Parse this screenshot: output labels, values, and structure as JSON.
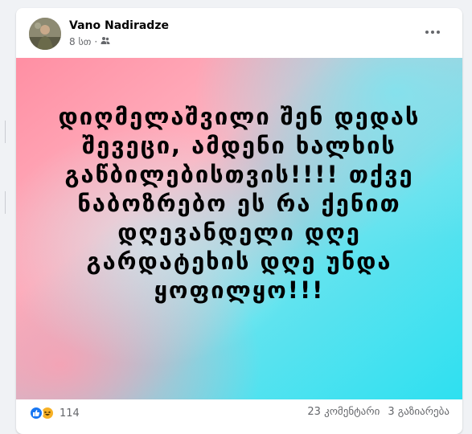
{
  "post": {
    "author": "Vano Nadiradze",
    "time": "8 სთ",
    "separator": "·",
    "text": "დიღმელაშვილი შენ დედას შევეცი, ამდენი ხალხის გაწბილებისთვის!!!! თქვე ნაბოზრებო ეს რა ქენით დღევანდელი დღე გარდატეხის დღე უნდა ყოფილყო!!!"
  },
  "footer": {
    "reactions_count": "114",
    "comments": "23 კომენტარი",
    "shares": "3 გაზიარება"
  },
  "icons": {
    "privacy": "friends-icon",
    "more": "more-options-icon",
    "like": "like-reaction-icon",
    "haha": "haha-reaction-icon"
  },
  "colors": {
    "bg": "#f0f2f5",
    "card": "#ffffff",
    "like_blue": "#1877f2",
    "haha_yellow": "#f7b125",
    "gradient_pink": "#ff9aa6",
    "gradient_cyan": "#37e3f2"
  }
}
